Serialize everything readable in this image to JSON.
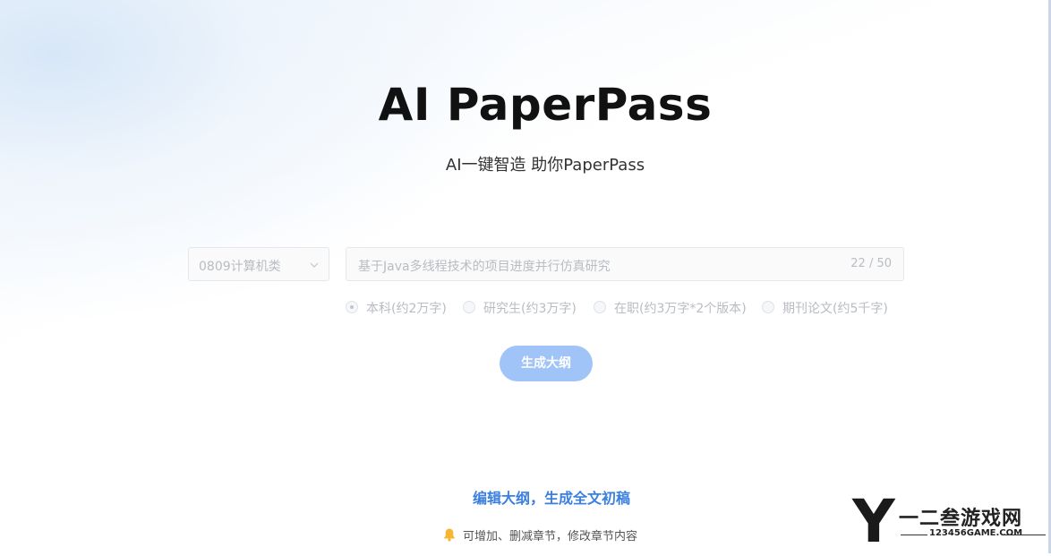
{
  "hero": {
    "title": "AI PaperPass",
    "subtitle": "AI一键智造 助你PaperPass"
  },
  "form": {
    "major_select": {
      "value": "0809计算机类",
      "icon": "chevron-down-icon"
    },
    "topic_input": {
      "value": "基于Java多线程技术的项目进度并行仿真研究",
      "counter": "22 / 50"
    },
    "paper_types": [
      {
        "label": "本科(约2万字)",
        "checked": true
      },
      {
        "label": "研究生(约3万字)",
        "checked": false
      },
      {
        "label": "在职(约3万字*2个版本)",
        "checked": false
      },
      {
        "label": "期刊论文(约5千字)",
        "checked": false
      }
    ],
    "generate_button": "生成大纲"
  },
  "feature": {
    "heading": "编辑大纲，生成全文初稿",
    "tip": "可增加、删减章节，修改章节内容",
    "tip_icon": "bell-icon"
  },
  "watermark": {
    "name": "一二叁游戏网",
    "url": "123456GAME.COM"
  },
  "colors": {
    "accent": "#3b7fe0",
    "button_disabled": "#a0c3f8",
    "bell": "#f5b731"
  }
}
